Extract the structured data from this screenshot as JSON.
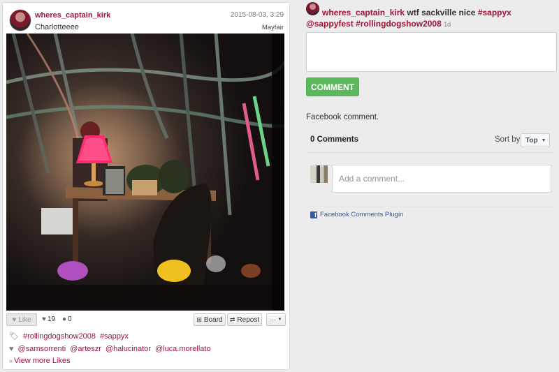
{
  "post": {
    "username": "wheres_captain_kirk",
    "timestamp": "2015-08-03, 3:29",
    "caption": "Charlotteeee",
    "location": "Mayfair"
  },
  "actions": {
    "like_label": "Like",
    "likes_count": "19",
    "comments_count": "0",
    "board_label": "Board",
    "repost_label": "Repost",
    "more_label": "···"
  },
  "tags": [
    "#rollingdogshow2008",
    "#sappyx"
  ],
  "likers": [
    "@samsorrenti",
    "@arteszr",
    "@halucinator",
    "@luca.morellato"
  ],
  "view_more_label": "View more Likes",
  "right": {
    "username": "wheres_captain_kirk",
    "text": "wtf sackville nice",
    "hashtags": [
      "#sappyx",
      "@sappyfest",
      "#rollingdogshow2008"
    ],
    "ago": "1d",
    "comment_button": "COMMENT",
    "fb_label": "Facebook comment."
  },
  "facebook": {
    "count_label": "0 Comments",
    "sort_label": "Sort by",
    "sort_value": "Top",
    "input_placeholder": "Add a comment...",
    "plugin_label": "Facebook Comments Plugin"
  },
  "colors": {
    "accent": "#a3143a",
    "comment_button": "#5cb85c",
    "facebook_blue": "#3b5998"
  }
}
